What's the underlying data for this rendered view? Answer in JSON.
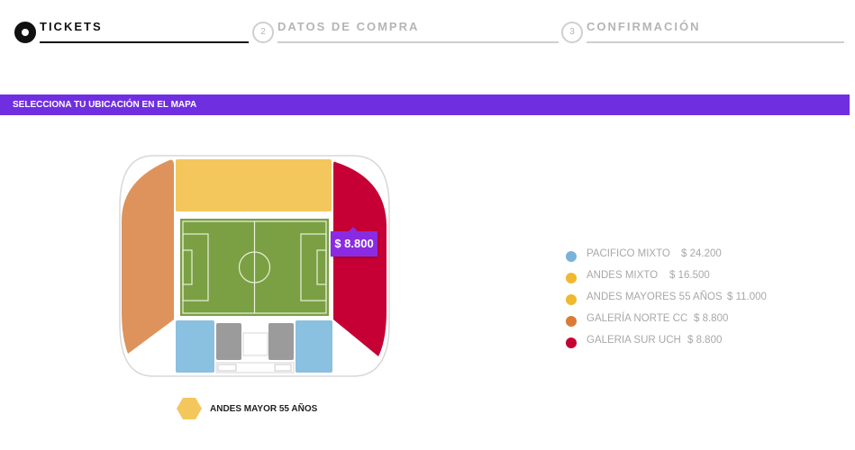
{
  "stepper": {
    "steps": [
      {
        "number": "",
        "label": "TICKETS",
        "active": true
      },
      {
        "number": "2",
        "label": "DATOS DE COMPRA",
        "active": false
      },
      {
        "number": "3",
        "label": "CONFIRMACIÓN",
        "active": false
      }
    ]
  },
  "banner": {
    "text": "SELECCIONA TU UBICACIÓN EN EL MAPA"
  },
  "map": {
    "tooltip_price": "$ 8.800",
    "selected_section": "ANDES MAYOR 55 AÑOS"
  },
  "legend": [
    {
      "name": "PACIFICO MIXTO",
      "price": "$ 24.200",
      "color": "#7ab2d9"
    },
    {
      "name": "ANDES MIXTO",
      "price": "$ 16.500",
      "color": "#f0b92e"
    },
    {
      "name": "ANDES MAYORES 55 AÑOS",
      "price": "$ 11.000",
      "color": "#f0b92e"
    },
    {
      "name": "GALERÍA NORTE CC",
      "price": "$ 8.800",
      "color": "#db7b36"
    },
    {
      "name": "GALERIA SUR UCH",
      "price": "$ 8.800",
      "color": "#c50033"
    }
  ],
  "colors": {
    "accent": "#6f2fe0",
    "pacifico": "#8ac0e0",
    "andes": "#f4c75c",
    "norte": "#dd935b",
    "sur": "#c60035",
    "field": "#7aa043",
    "grey_block": "#9b9b9b"
  }
}
